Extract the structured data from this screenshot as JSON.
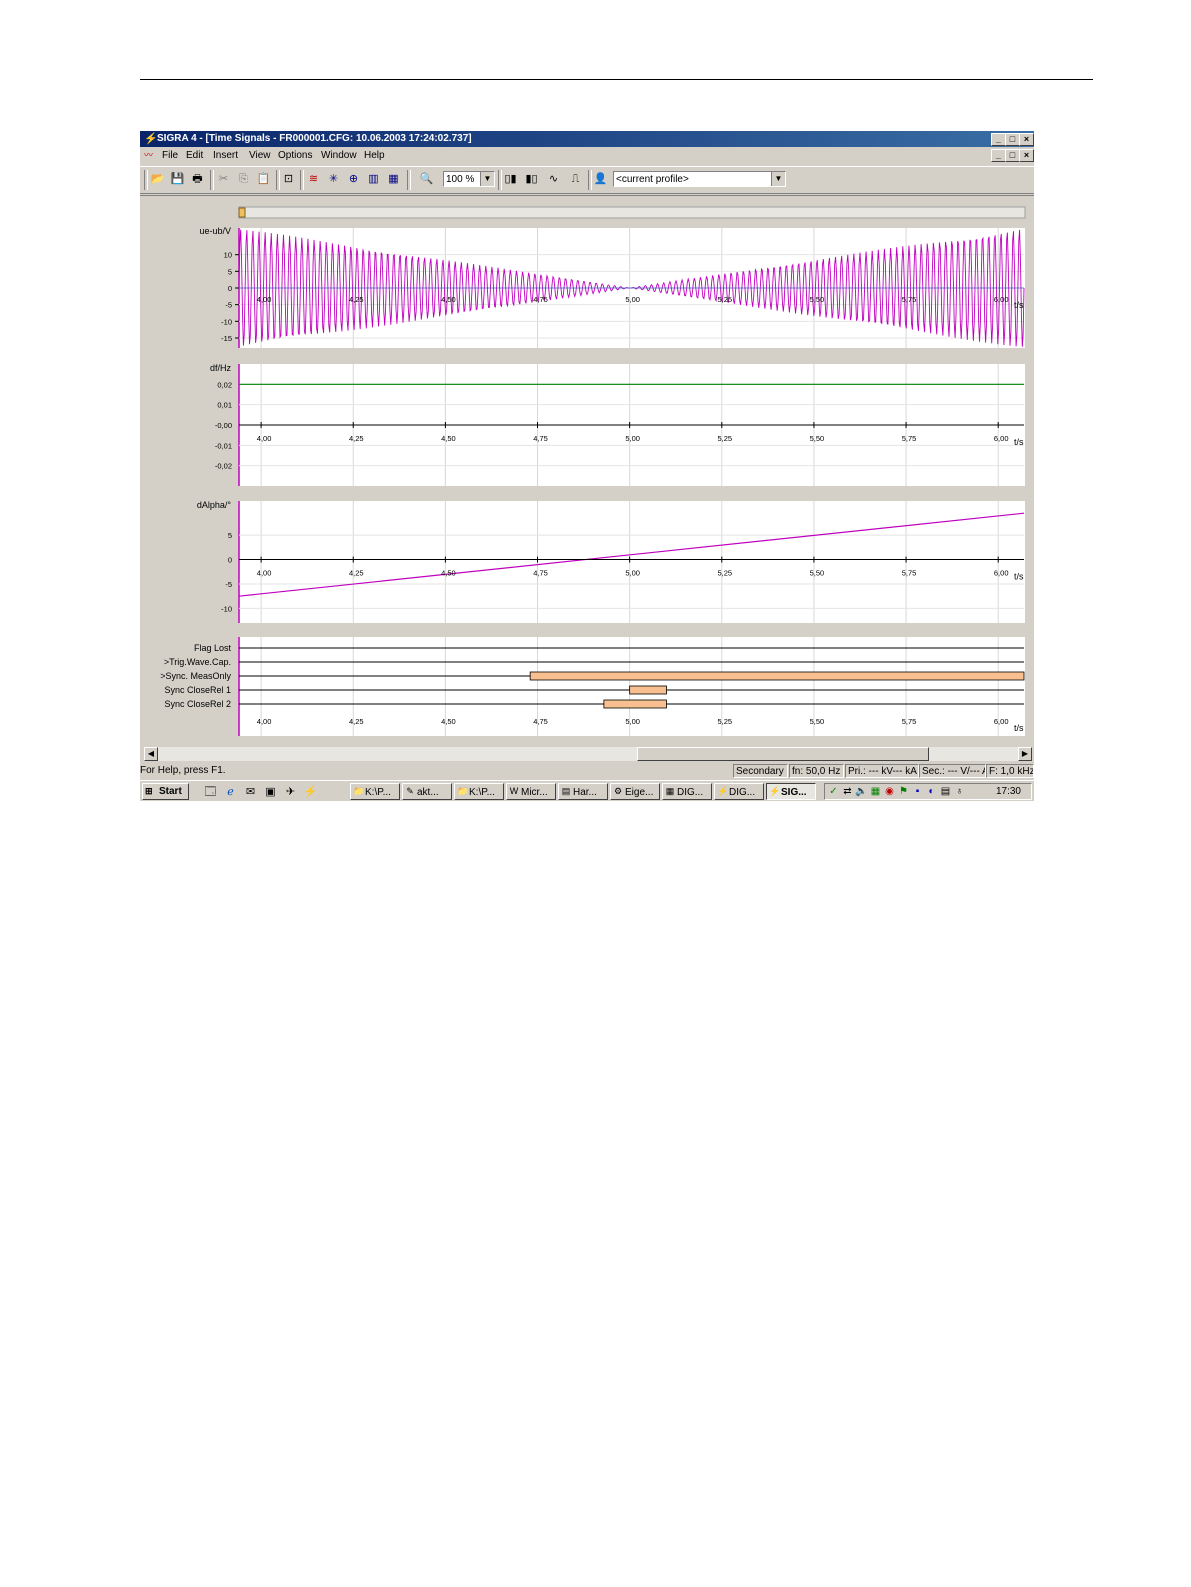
{
  "window": {
    "title": "SIGRA 4 - [Time Signals - FR000001.CFG: 10.06.2003 17:24:02.737]",
    "controls": [
      "_",
      "□",
      "×"
    ]
  },
  "menu": [
    "File",
    "Edit",
    "Insert",
    "View",
    "Options",
    "Window",
    "Help"
  ],
  "toolbar": {
    "buttons": [
      "open-icon",
      "save-icon",
      "print-icon",
      "cut-icon",
      "copy-icon",
      "paste-icon",
      "zoom-fit-icon",
      "time-signals-icon",
      "vector-icon",
      "circle-diagram-icon",
      "harmonics-icon",
      "table-icon",
      "zoom-icon"
    ],
    "zoom_value": "100 %",
    "profile_value": "<current profile>"
  },
  "colors": {
    "signal": "#c000c0",
    "df_line": "#008000",
    "bar": "#f8c090",
    "panel_bg": "#ffffff",
    "app_bg": "#d4d0c8"
  },
  "chart_data": [
    {
      "type": "line",
      "ylabel": "ue-ub/V",
      "xlabel": "t/s",
      "xticks": [
        "4,00",
        "4,25",
        "4,50",
        "4,75",
        "5,00",
        "5,25",
        "5,50",
        "5,75",
        "6,00"
      ],
      "yticks": [
        "10",
        "5",
        "0",
        "-5",
        "-10",
        "-15"
      ],
      "xlim": [
        3.94,
        6.07
      ],
      "ylim": [
        -18,
        18
      ],
      "series": [
        {
          "description": "beating sine, amplitude envelope",
          "x": [
            3.94,
            5.0,
            6.07
          ],
          "y_amplitude": [
            18,
            0,
            18
          ]
        }
      ]
    },
    {
      "type": "line",
      "ylabel": "df/Hz",
      "xlabel": "t/s",
      "xticks": [
        "4,00",
        "4,25",
        "4,50",
        "4,75",
        "5,00",
        "5,25",
        "5,50",
        "5,75",
        "6,00"
      ],
      "yticks": [
        "0,02",
        "0,01",
        "-0,00",
        "-0,01",
        "-0,02"
      ],
      "xlim": [
        3.94,
        6.07
      ],
      "ylim": [
        -0.03,
        0.03
      ],
      "series": [
        {
          "x": [
            3.94,
            6.07
          ],
          "y": [
            0.02,
            0.02
          ]
        }
      ]
    },
    {
      "type": "line",
      "ylabel": "dAlpha/°",
      "xlabel": "t/s",
      "xticks": [
        "4,00",
        "4,25",
        "4,50",
        "4,75",
        "5,00",
        "5,25",
        "5,50",
        "5,75",
        "6,00"
      ],
      "yticks": [
        "5",
        "0",
        "-5",
        "-10"
      ],
      "xlim": [
        3.94,
        6.07
      ],
      "ylim": [
        -13,
        12
      ],
      "series": [
        {
          "x": [
            3.94,
            6.07
          ],
          "y": [
            -7.5,
            9.5
          ]
        }
      ]
    },
    {
      "type": "bar",
      "xlabel": "t/s",
      "xticks": [
        "4,00",
        "4,25",
        "4,50",
        "4,75",
        "5,00",
        "5,25",
        "5,50",
        "5,75",
        "6,00"
      ],
      "xlim": [
        3.94,
        6.07
      ],
      "categories": [
        "Flag Lost",
        ">Trig.Wave.Cap.",
        ">Sync. MeasOnly",
        "Sync CloseRel 1",
        "Sync CloseRel 2"
      ],
      "intervals": [
        [],
        [],
        [
          [
            4.73,
            6.07
          ]
        ],
        [
          [
            5.0,
            5.1
          ]
        ],
        [
          [
            4.93,
            5.1
          ]
        ]
      ]
    }
  ],
  "statusbar": {
    "help": "For Help, press F1.",
    "mode": "Secondary",
    "fn": "fn: 50,0 Hz",
    "pri": "Pri.: --- kV--- kA",
    "sec": "Sec.: --- V/--- A",
    "f": "F: 1,0 kHz"
  },
  "taskbar": {
    "start": "Start",
    "quicklaunch": [
      "desktop-icon",
      "ie-icon",
      "outlook-icon",
      "app-icon",
      "app2-icon",
      "app3-icon"
    ],
    "tasks": [
      "K:\\P...",
      "akt...",
      "K:\\P...",
      "Micr...",
      "Har...",
      "Eige...",
      "DIG...",
      "DIG...",
      "SIG..."
    ],
    "active_task": 8,
    "clock": "17:30"
  }
}
